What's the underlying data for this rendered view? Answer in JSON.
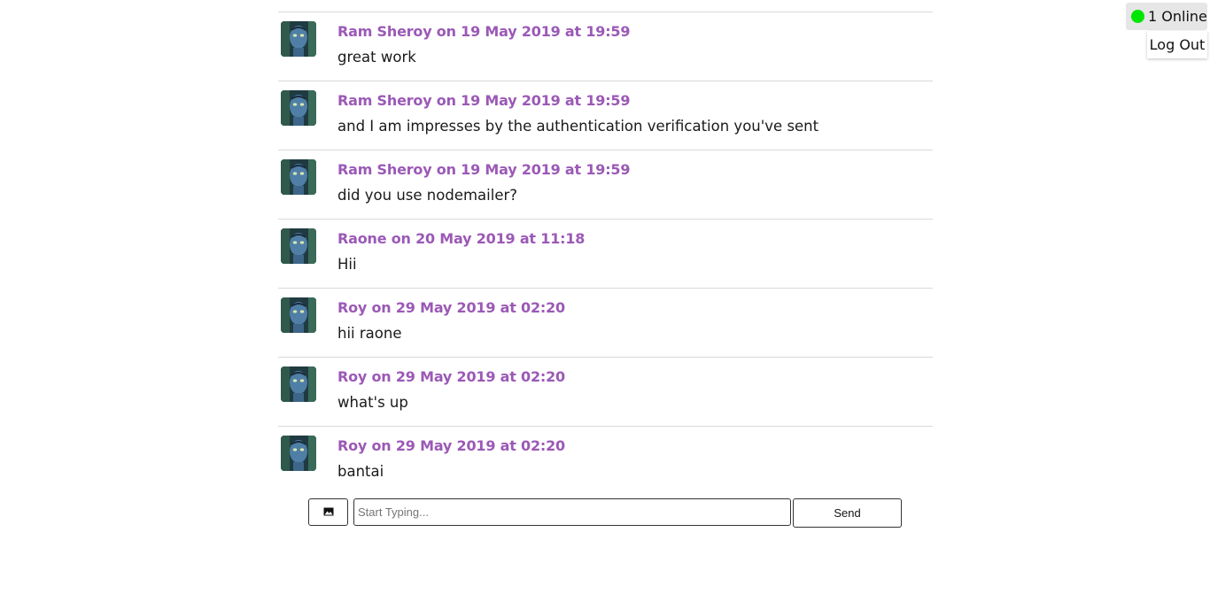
{
  "messages": [
    {
      "meta": "Ram Sheroy on 19 May 2019 at 19:59",
      "text": "great work"
    },
    {
      "meta": "Ram Sheroy on 19 May 2019 at 19:59",
      "text": "and I am impresses by the authentication verification you've sent"
    },
    {
      "meta": "Ram Sheroy on 19 May 2019 at 19:59",
      "text": "did you use nodemailer?"
    },
    {
      "meta": "Raone on 20 May 2019 at 11:18",
      "text": "Hii"
    },
    {
      "meta": "Roy on 29 May 2019 at 02:20",
      "text": "hii raone"
    },
    {
      "meta": "Roy on 29 May 2019 at 02:20",
      "text": "what's up"
    },
    {
      "meta": "Roy on 29 May 2019 at 02:20",
      "text": "bantai"
    }
  ],
  "composer": {
    "image_icon": "image-icon",
    "placeholder": "Start Typing...",
    "value": "",
    "send_label": "Send"
  },
  "status": {
    "online_label": "1 Online",
    "online_color": "#00e600",
    "logout_label": "Log Out"
  },
  "colors": {
    "author_meta": "#9b59b6"
  }
}
